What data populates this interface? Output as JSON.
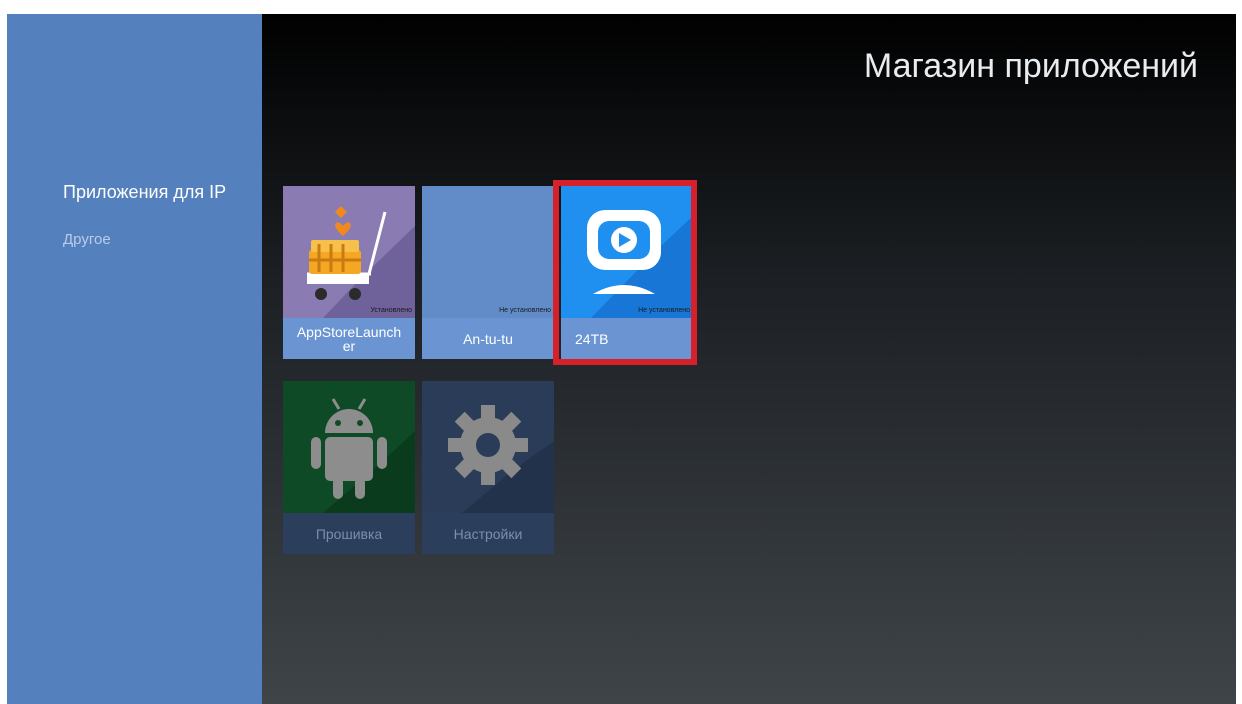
{
  "colors": {
    "sidebar": "#5481bd",
    "tile": "#6a95d2",
    "focus": "#d7202a",
    "text_dim": "#b8cce6"
  },
  "sidebar": {
    "categories": [
      {
        "label": "Приложения для  IP",
        "selected": true
      },
      {
        "label": "Другое",
        "selected": false
      }
    ]
  },
  "header": {
    "title": "Магазин приложений"
  },
  "apps": [
    {
      "name": "AppStoreLauncher",
      "status": "Установлено",
      "icon": "shopping-cart-icon"
    },
    {
      "name": "An-tu-tu",
      "status": "Не установлено",
      "icon": ""
    },
    {
      "name": "24ТВ",
      "status": "Не установлено",
      "icon": "tv-play-icon",
      "focused": true
    },
    {
      "name": "Прошивка",
      "status": "",
      "icon": "android-icon"
    },
    {
      "name": "Настройки",
      "status": "",
      "icon": "gear-icon"
    }
  ]
}
